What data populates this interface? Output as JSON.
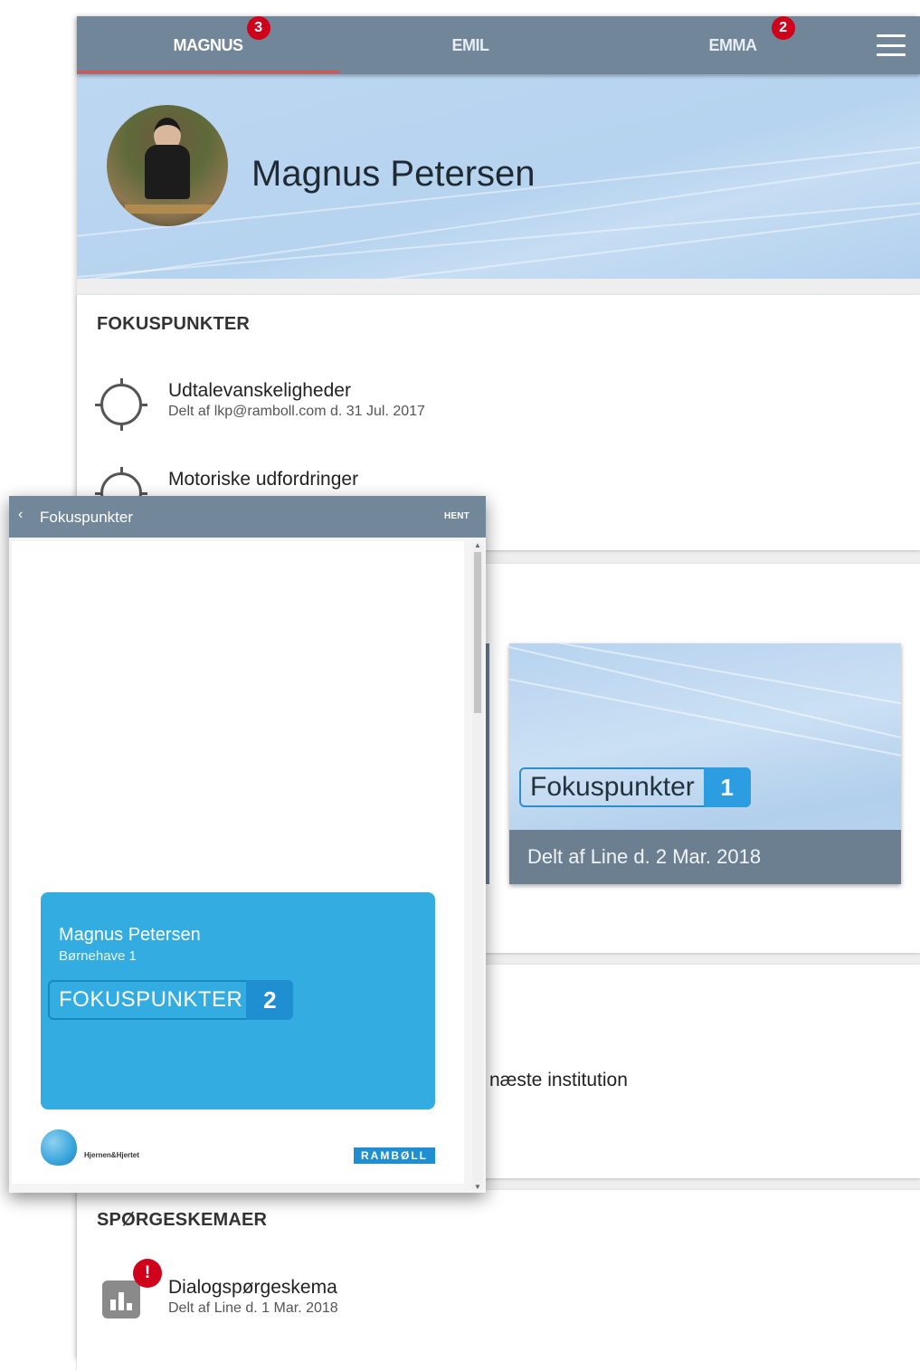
{
  "tabs": [
    {
      "label": "MAGNUS",
      "badge": "3"
    },
    {
      "label": "EMIL",
      "badge": ""
    },
    {
      "label": "EMMA",
      "badge": "2"
    }
  ],
  "profile": {
    "name": "Magnus Petersen"
  },
  "fokuspunkter": {
    "title": "FOKUSPUNKTER",
    "items": [
      {
        "title": "Udtalevanskeligheder",
        "sub": "Delt af lkp@ramboll.com d. 31 Jul. 2017"
      },
      {
        "title": "Motoriske udfordringer",
        "sub": ""
      }
    ]
  },
  "tile": {
    "label": "Fokuspunkter",
    "count": "1",
    "footer": "Delt af Line d. 2 Mar. 2018"
  },
  "section3": {
    "partial_text": "næste institution"
  },
  "questionnaires": {
    "title": "SPØRGESKEMAER",
    "items": [
      {
        "title": "Dialogspørgeskema",
        "sub": "Delt af Line d. 1 Mar. 2018",
        "alert": "!"
      }
    ]
  },
  "popup": {
    "back": "‹",
    "title": "Fokuspunkter",
    "action": "HENT",
    "doc": {
      "name": "Magnus Petersen",
      "sub": "Børnehave 1",
      "label": "FOKUSPUNKTER",
      "count": "2"
    },
    "brand_left": "Hjernen&Hjertet",
    "brand_right": "RAMBØLL"
  },
  "colors": {
    "tabbar": "#718699",
    "badge": "#d0021b",
    "accent": "#33ace1",
    "header": "#bcd7f1"
  }
}
